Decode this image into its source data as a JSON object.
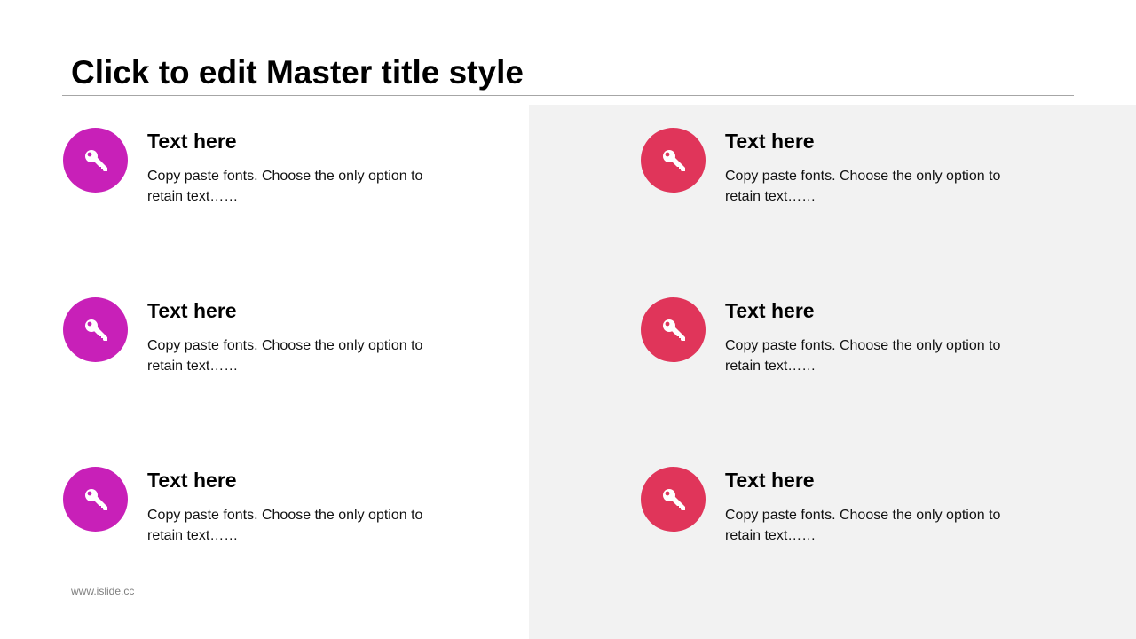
{
  "slide": {
    "title": "Click to edit Master title style",
    "footer": "www.islide.cc"
  },
  "colors": {
    "left_accent": "#C820B8",
    "right_accent": "#E0355A",
    "right_panel_bg": "#F2F2F2"
  },
  "items": [
    {
      "heading": "Text here",
      "body": "Copy paste fonts. Choose the only option to retain text……",
      "icon": "key-icon"
    },
    {
      "heading": "Text here",
      "body": "Copy paste fonts. Choose the only option to retain text……",
      "icon": "key-icon"
    },
    {
      "heading": "Text here",
      "body": "Copy paste fonts. Choose the only option to retain text……",
      "icon": "key-icon"
    },
    {
      "heading": "Text here",
      "body": "Copy paste fonts. Choose the only option to retain text……",
      "icon": "key-icon"
    },
    {
      "heading": "Text here",
      "body": "Copy paste fonts. Choose the only option to retain text……",
      "icon": "key-icon"
    },
    {
      "heading": "Text here",
      "body": "Copy paste fonts. Choose the only option to retain text……",
      "icon": "key-icon"
    }
  ]
}
